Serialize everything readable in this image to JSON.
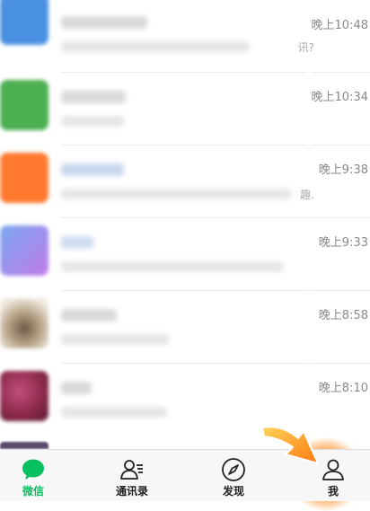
{
  "chat_list": {
    "rows": [
      {
        "time": "晚上10:48",
        "snippet_tail": "讯?",
        "avatar_color": "#4a90e2"
      },
      {
        "time": "晚上10:34",
        "snippet_tail": "",
        "avatar_color": "#4caf50"
      },
      {
        "time": "晚上9:38",
        "snippet_tail": "趣.",
        "avatar_color": "#ff7a2e"
      },
      {
        "time": "晚上9:33",
        "snippet_tail": "",
        "avatar_color": "#b07be8"
      },
      {
        "time": "晚上8:58",
        "snippet_tail": "",
        "avatar_color": "#bca98e"
      },
      {
        "time": "晚上8:10",
        "snippet_tail": "",
        "avatar_color": "#8e2a4e"
      }
    ]
  },
  "tabbar": {
    "tabs": [
      {
        "label": "微信",
        "icon": "chat-bubble-icon",
        "active": true
      },
      {
        "label": "通讯录",
        "icon": "contacts-icon",
        "active": false
      },
      {
        "label": "发现",
        "icon": "compass-icon",
        "active": false
      },
      {
        "label": "我",
        "icon": "person-icon",
        "active": false
      }
    ],
    "active_color": "#07c160",
    "highlight_color": "#ff8c1e"
  }
}
